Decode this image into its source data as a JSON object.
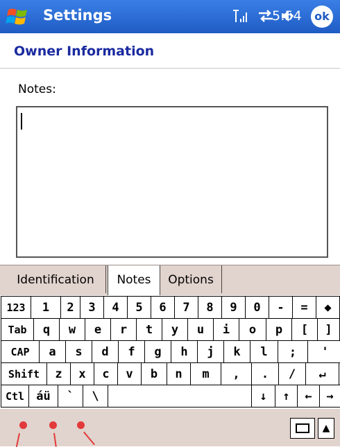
{
  "titlebar": {
    "app_title": "Settings",
    "time": "5:54",
    "ok_label": "ok",
    "icons": [
      "signal-icon",
      "sync-icon",
      "volume-icon"
    ]
  },
  "page": {
    "title": "Owner Information",
    "notes_label": "Notes:",
    "notes_value": ""
  },
  "tabs": [
    {
      "label": "Identification",
      "selected": false
    },
    {
      "label": "Notes",
      "selected": true
    },
    {
      "label": "Options",
      "selected": false
    }
  ],
  "keyboard": {
    "row1": [
      "123",
      "1",
      "2",
      "3",
      "4",
      "5",
      "6",
      "7",
      "8",
      "9",
      "0",
      "-",
      "=",
      "◆"
    ],
    "row2": [
      "Tab",
      "q",
      "w",
      "e",
      "r",
      "t",
      "y",
      "u",
      "i",
      "o",
      "p",
      "[",
      "]"
    ],
    "row3": [
      "CAP",
      "a",
      "s",
      "d",
      "f",
      "g",
      "h",
      "j",
      "k",
      "l",
      ";",
      "'"
    ],
    "row4": [
      "Shift",
      "z",
      "x",
      "c",
      "v",
      "b",
      "n",
      "m",
      ",",
      ".",
      "/",
      "↵"
    ],
    "row5": [
      "Ctl",
      "áü",
      "`",
      "\\",
      "",
      "↓",
      "↑",
      "←",
      "→"
    ]
  },
  "bottombar": {
    "sip_icon": "keyboard-icon",
    "sip_arrow": "▲"
  },
  "colors": {
    "titlebar": "#1f5cc4",
    "page_title": "#1a2aa0",
    "panel": "#e1d3cd",
    "annotation": "#e23a3a"
  }
}
